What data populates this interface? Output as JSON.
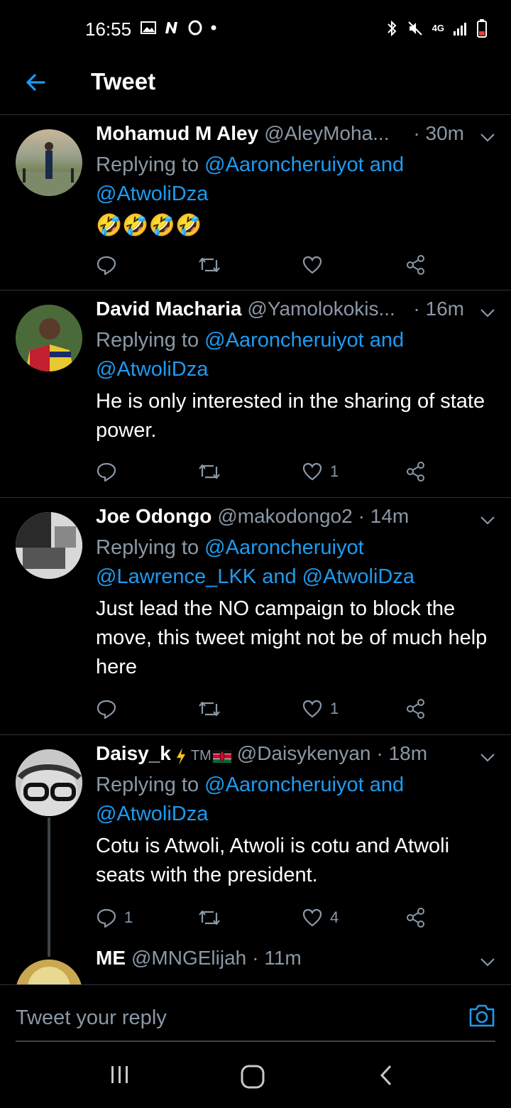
{
  "status_bar": {
    "time": "16:55",
    "network": "4G"
  },
  "header": {
    "title": "Tweet"
  },
  "tweets": [
    {
      "author": "Mohamud M Aley",
      "handle": "@AleyMoha...",
      "time": "· 30m",
      "reply_prefix": "Replying to",
      "reply_mention_1": "@Aaroncheruiyot",
      "reply_and": "and",
      "reply_mention_2": "@AtwoliDza",
      "text": "🤣🤣🤣🤣",
      "replies": "",
      "likes": ""
    },
    {
      "author": "David Macharia",
      "handle": "@Yamolokokis...",
      "time": "· 16m",
      "reply_prefix": "Replying to",
      "reply_mention_1": "@Aaroncheruiyot",
      "reply_and": "and",
      "reply_mention_2": "@AtwoliDza",
      "text": "He is only interested in the sharing of state power.",
      "replies": "",
      "likes": "1"
    },
    {
      "author": "Joe Odongo",
      "handle": "@makodongo2",
      "time": "· 14m",
      "reply_prefix": "Replying to",
      "reply_mention_1": "@Aaroncheruiyot",
      "reply_mention_2": "@Lawrence_LKK",
      "reply_and": "and",
      "reply_mention_3": "@AtwoliDza",
      "text": "Just lead the NO campaign to block the move, this tweet might not be of much help here",
      "replies": "",
      "likes": "1"
    },
    {
      "author": "Daisy_k",
      "author_badge": "TM",
      "handle": "@Daisykenyan",
      "time": "· 18m",
      "reply_prefix": "Replying to",
      "reply_mention_1": "@Aaroncheruiyot",
      "reply_and": "and",
      "reply_mention_2": "@AtwoliDza",
      "text": "Cotu is Atwoli, Atwoli is cotu and Atwoli seats with the president.",
      "replies": "1",
      "likes": "4"
    },
    {
      "author": "ME",
      "handle": "@MNGElijah",
      "time": "· 11m"
    }
  ],
  "reply_bar": {
    "placeholder": "Tweet your reply"
  },
  "colors": {
    "accent": "#1d9bf0",
    "muted": "#8b98a5",
    "divider": "#2f3336",
    "background": "#000000"
  },
  "icons": [
    "back-arrow-icon",
    "chevron-down-icon",
    "reply-icon",
    "retweet-icon",
    "like-icon",
    "share-icon",
    "camera-icon",
    "recents-icon",
    "home-icon",
    "back-icon"
  ]
}
